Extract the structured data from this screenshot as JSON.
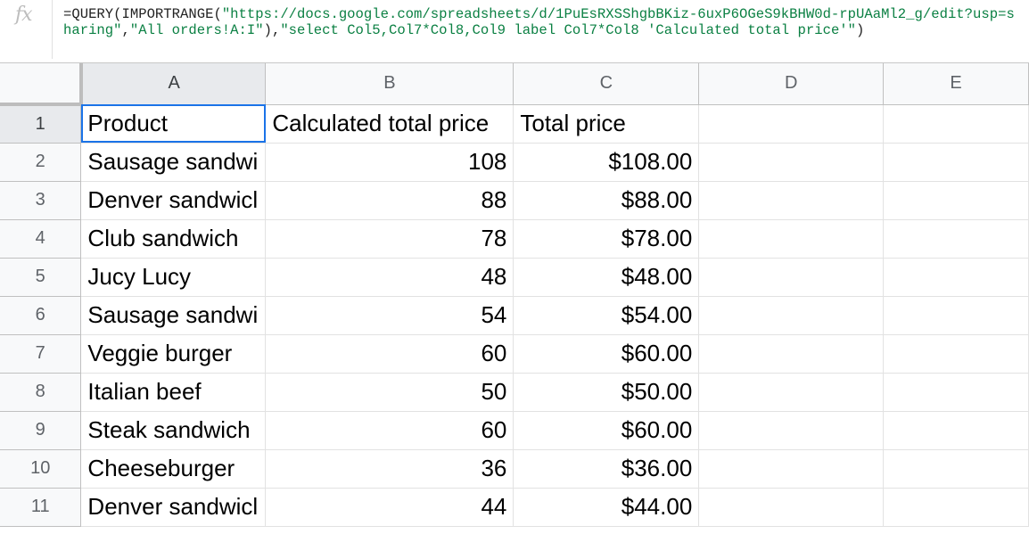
{
  "formula_bar": {
    "icon": "fx-icon",
    "prefix": "=QUERY(IMPORTRANGE(",
    "url_string": "\"https://docs.google.com/spreadsheets/d/1PuEsRXSShgbBKiz-6uxP6OGeS9kBHW0d-rpUAaMl2_g/edit?usp=sharing\"",
    "sep1": ",",
    "range_string": "\"All orders!A:I\"",
    "sep2": "),",
    "query_string": "\"select Col5,Col7*Col8,Col9 label Col7*Col8 'Calculated total price'\"",
    "suffix": ")"
  },
  "columns": [
    "A",
    "B",
    "C",
    "D",
    "E"
  ],
  "rows": [
    {
      "num": "1",
      "product": "Product",
      "calculated": "Calculated total price",
      "total": "Total price"
    },
    {
      "num": "2",
      "product": "Sausage sandwi",
      "calculated": "108",
      "total": "$108.00"
    },
    {
      "num": "3",
      "product": "Denver sandwicl",
      "calculated": "88",
      "total": "$88.00"
    },
    {
      "num": "4",
      "product": "Club sandwich",
      "calculated": "78",
      "total": "$78.00"
    },
    {
      "num": "5",
      "product": "Jucy Lucy",
      "calculated": "48",
      "total": "$48.00"
    },
    {
      "num": "6",
      "product": "Sausage sandwi",
      "calculated": "54",
      "total": "$54.00"
    },
    {
      "num": "7",
      "product": "Veggie burger",
      "calculated": "60",
      "total": "$60.00"
    },
    {
      "num": "8",
      "product": "Italian beef",
      "calculated": "50",
      "total": "$50.00"
    },
    {
      "num": "9",
      "product": "Steak sandwich",
      "calculated": "60",
      "total": "$60.00"
    },
    {
      "num": "10",
      "product": "Cheeseburger",
      "calculated": "36",
      "total": "$36.00"
    },
    {
      "num": "11",
      "product": "Denver sandwicl",
      "calculated": "44",
      "total": "$44.00"
    }
  ],
  "colors": {
    "selection": "#1a73e8",
    "formula_string": "#0b8043",
    "header_bg": "#f8f9fa"
  }
}
